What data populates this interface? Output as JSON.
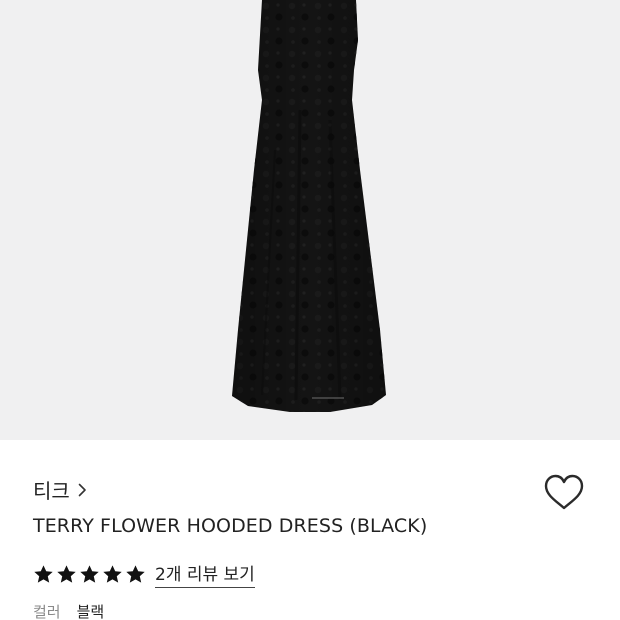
{
  "product": {
    "brand": "티크",
    "name": "TERRY FLOWER HOODED DRESS (BLACK)",
    "review_link": "2개 리뷰 보기",
    "rating": 5,
    "rating_max": 5,
    "color_label": "컬러",
    "color_value": "블랙"
  },
  "icons": {
    "brand_chevron": "chevron-right-icon",
    "wishlist": "heart-outline-icon",
    "star": "star-filled-icon"
  },
  "colors": {
    "image_background": "#f0f0f1",
    "dress": "#141414",
    "text": "#222222",
    "muted_text": "#8a8a8a"
  }
}
